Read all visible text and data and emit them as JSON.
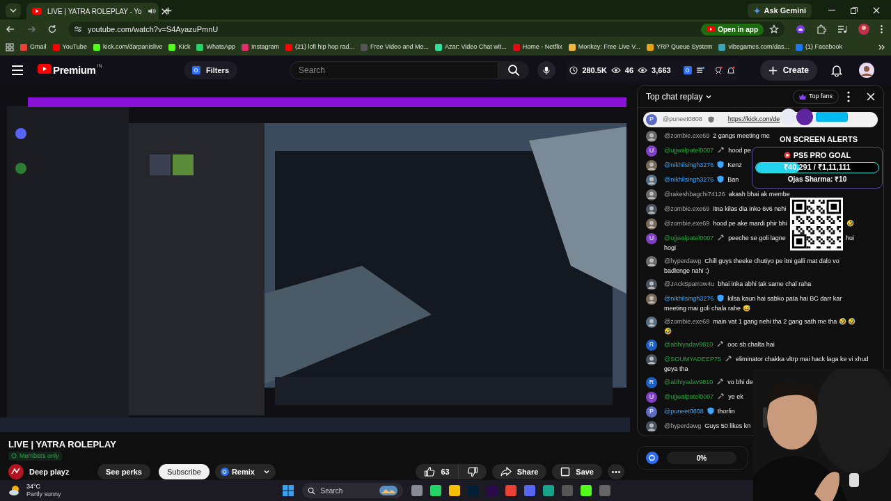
{
  "browser": {
    "tab": {
      "title": "LIVE | YATRA ROLEPLAY - Yo"
    },
    "ask_gemini": "Ask Gemini",
    "url": "youtube.com/watch?v=S4AyazuPmnU",
    "open_in_app": "Open in app",
    "bookmarks": [
      {
        "label": "Gmail",
        "color": "#ea4335"
      },
      {
        "label": "YouTube",
        "color": "#ff0000"
      },
      {
        "label": "kick.com/darpanislive",
        "color": "#53fc18"
      },
      {
        "label": "Kick",
        "color": "#53fc18"
      },
      {
        "label": "WhatsApp",
        "color": "#25d366"
      },
      {
        "label": "Instagram",
        "color": "#e1306c"
      },
      {
        "label": "(21) lofi hip hop rad...",
        "color": "#ff0000"
      },
      {
        "label": "Free Video and Me...",
        "color": "#555555"
      },
      {
        "label": "Azar: Video Chat wit...",
        "color": "#2fe0a0"
      },
      {
        "label": "Home - Netflix",
        "color": "#e50914"
      },
      {
        "label": "Monkey: Free Live V...",
        "color": "#f5b642"
      },
      {
        "label": "YRP Queue System",
        "color": "#e8a317"
      },
      {
        "label": "vibegames.com/das...",
        "color": "#3aa6b9"
      },
      {
        "label": "(1) Facebook",
        "color": "#1877f2"
      }
    ]
  },
  "header": {
    "logo": "Premium",
    "region": "IN",
    "filters": "Filters",
    "search": {
      "placeholder": "Search"
    },
    "stats": [
      "280.5K",
      "46",
      "3,663"
    ],
    "create": "Create"
  },
  "info": {
    "title": "LIVE | YATRA ROLEPLAY",
    "badge": "Members only",
    "channel": "Deep playz",
    "see_perks": "See perks",
    "subscribe": "Subscribe",
    "remix": "Remix",
    "likes": "63",
    "share": "Share",
    "save": "Save"
  },
  "chat": {
    "title": "Top chat replay",
    "top_fans": "Top fans",
    "pinned": {
      "avatar": "P",
      "author": "@puneet0808",
      "link": "https://kick.com/de"
    },
    "messages": [
      {
        "author": "@zombie.exe69",
        "kind": "viewer",
        "text": "2 gangs meeting me"
      },
      {
        "avatar": "U",
        "author": "@ujjwalpatel0007",
        "kind": "member",
        "text": "hood pe"
      },
      {
        "author": "@nikhilsingh3276",
        "kind": "moderator",
        "text": "Kenz"
      },
      {
        "author": "@nikhilsingh3276",
        "kind": "moderator",
        "text": "Ban"
      },
      {
        "author": "@rakeshbagchi74126",
        "kind": "viewer",
        "text": "akash bhai ak membe"
      },
      {
        "author": "@zombie.exe69",
        "kind": "viewer",
        "text": "itna kilas dia inko 6v6 nehi"
      },
      {
        "author": "@zombie.exe69",
        "kind": "viewer",
        "text": "hood pe ake mardi phir bhi",
        "tail": "🤣"
      },
      {
        "avatar": "U",
        "author": "@ujjwalpatel0007",
        "kind": "member",
        "text": "peeche se goli lagne",
        "tail": "hui",
        "more": "hogi"
      },
      {
        "author": "@hyperdawg",
        "kind": "viewer",
        "text": "Chill guys theeke chutiyo pe itni galli mat dalo vo",
        "more": "badlenge nahi :)"
      },
      {
        "author": "@JAckSparrow4u",
        "kind": "viewer",
        "text": "bhai inka abhi tak same chal raha"
      },
      {
        "author": "@nikhilsingh3276",
        "kind": "moderator",
        "text": "kilsa kaun hai sabko pata hai BC darr kar",
        "more": "meeting mai goli chala rahe 😅"
      },
      {
        "author": "@zombie.exe69",
        "kind": "viewer",
        "text": "main vat 1 gang nehi tha 2 gang sath me tha 🤣 🤣",
        "more": "🤣"
      },
      {
        "avatar": "R",
        "author": "@abhiyadav9810",
        "kind": "member",
        "text": "ooc sb chalta hai"
      },
      {
        "author": "@SOUMYADEEP75",
        "kind": "member",
        "text": "eliminator chakka vltrp mai hack laga ke vi xhud",
        "more": "geya tha"
      },
      {
        "avatar": "R",
        "author": "@abhiyadav9810",
        "kind": "member",
        "text": "vo bhi de"
      },
      {
        "avatar": "U",
        "author": "@ujjwalpatel0007",
        "kind": "member",
        "text": "ye ek"
      },
      {
        "avatar": "P",
        "author": "@puneet0808",
        "kind": "moderator",
        "text": "thorfin"
      },
      {
        "author": "@hyperdawg",
        "kind": "viewer",
        "text": "Guys 50 likes kn"
      }
    ],
    "meter": {
      "reading": "0%"
    }
  },
  "overlay": {
    "alerts": "ON SCREEN ALERTS",
    "goal_title": "PS5 PRO GOAL",
    "goal_amount": "₹40,291 / ₹1,11,111",
    "level": 0.36,
    "last": "Ojas Sharma: ₹10"
  },
  "taskbar": {
    "temp": "34°C",
    "weather": "Partly sunny",
    "search": "Search"
  }
}
